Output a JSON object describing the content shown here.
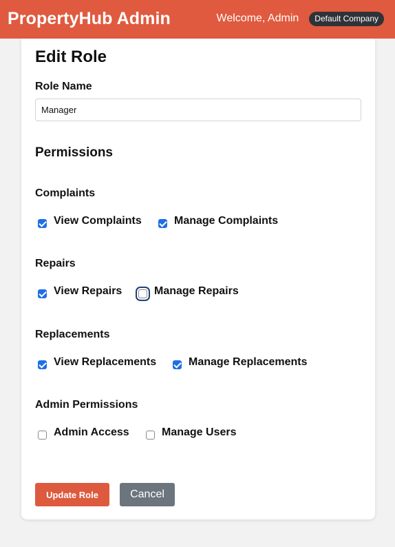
{
  "header": {
    "brand": "PropertyHub Admin",
    "welcome": "Welcome, Admin",
    "company": "Default Company"
  },
  "form": {
    "title": "Edit Role",
    "role_name_label": "Role Name",
    "role_name_value": "Manager",
    "permissions_title": "Permissions",
    "groups": [
      {
        "title": "Complaints",
        "perms": [
          {
            "label": "View Complaints",
            "checked": true
          },
          {
            "label": "Manage Complaints",
            "checked": true
          }
        ]
      },
      {
        "title": "Repairs",
        "perms": [
          {
            "label": "View Repairs",
            "checked": true
          },
          {
            "label": "Manage Repairs",
            "checked": false
          }
        ]
      },
      {
        "title": "Replacements",
        "perms": [
          {
            "label": "View Replacements",
            "checked": true
          },
          {
            "label": "Manage Replacements",
            "checked": true
          }
        ]
      },
      {
        "title": "Admin Permissions",
        "perms": [
          {
            "label": "Admin Access",
            "checked": false
          },
          {
            "label": "Manage Users",
            "checked": false
          }
        ]
      }
    ],
    "update_label": "Update Role",
    "cancel_label": "Cancel"
  },
  "colors": {
    "brand": "#e05a3f",
    "checkbox_checked": "#1f6fe5",
    "secondary_button": "#6c757d"
  }
}
